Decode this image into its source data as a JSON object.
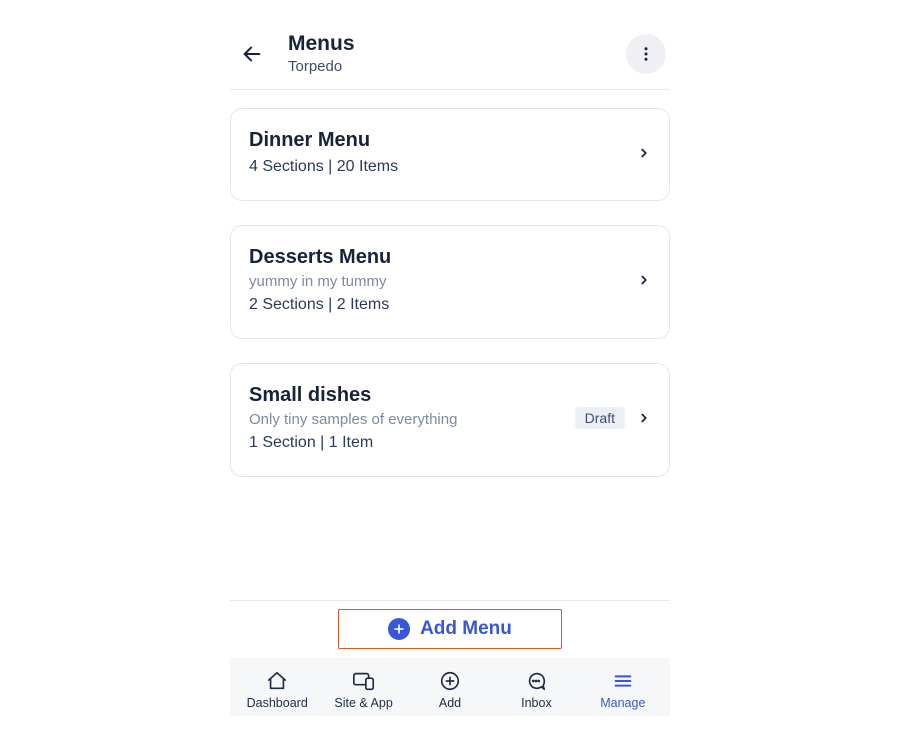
{
  "header": {
    "title": "Menus",
    "subtitle": "Torpedo"
  },
  "menus": [
    {
      "title": "Dinner Menu",
      "desc": "",
      "stats": "4 Sections | 20 Items",
      "badge": ""
    },
    {
      "title": "Desserts Menu",
      "desc": "yummy in my tummy",
      "stats": "2 Sections | 2 Items",
      "badge": ""
    },
    {
      "title": "Small dishes",
      "desc": "Only tiny samples of everything",
      "stats": "1 Section | 1 Item",
      "badge": "Draft"
    }
  ],
  "add_button": {
    "label": "Add Menu"
  },
  "nav": [
    {
      "label": "Dashboard",
      "active": false
    },
    {
      "label": "Site & App",
      "active": false
    },
    {
      "label": "Add",
      "active": false
    },
    {
      "label": "Inbox",
      "active": false
    },
    {
      "label": "Manage",
      "active": true
    }
  ]
}
